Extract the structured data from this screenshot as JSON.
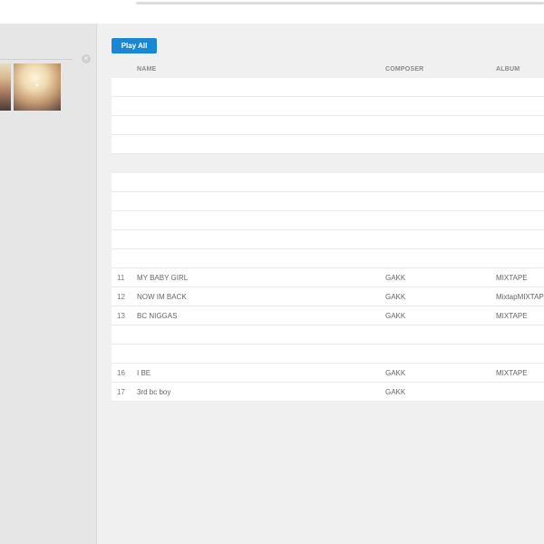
{
  "toolbar": {
    "play_all_label": "Play All"
  },
  "table": {
    "columns": {
      "name": "NAME",
      "composer": "COMPOSER",
      "album": "ALBUM"
    },
    "rows": [
      {
        "num": "",
        "name": "",
        "composer": "",
        "album": ""
      },
      {
        "num": "",
        "name": "",
        "composer": "",
        "album": ""
      },
      {
        "num": "",
        "name": "",
        "composer": "",
        "album": ""
      },
      {
        "num": "",
        "name": "",
        "composer": "",
        "album": ""
      },
      {
        "gap": true
      },
      {
        "num": "",
        "name": "",
        "composer": "",
        "album": ""
      },
      {
        "num": "",
        "name": "",
        "composer": "",
        "album": ""
      },
      {
        "num": "",
        "name": "",
        "composer": "",
        "album": ""
      },
      {
        "num": "",
        "name": "",
        "composer": "",
        "album": ""
      },
      {
        "num": "",
        "name": "",
        "composer": "",
        "album": ""
      },
      {
        "num": "11",
        "name": "MY BABY GIRL",
        "composer": "GAKK",
        "album": "MIXTAPE"
      },
      {
        "num": "12",
        "name": "NOW IM BACK",
        "composer": "GAKK",
        "album": "MixtapMIXTAPE"
      },
      {
        "num": "13",
        "name": "BC NIGGAS",
        "composer": "GAKK",
        "album": "MIXTAPE"
      },
      {
        "num": "",
        "name": "",
        "composer": "",
        "album": ""
      },
      {
        "num": "",
        "name": "",
        "composer": "",
        "album": ""
      },
      {
        "num": "16",
        "name": "I BE",
        "composer": "GAKK",
        "album": "MIXTAPE"
      },
      {
        "num": "17",
        "name": "3rd bc boy",
        "composer": "GAKK",
        "album": ""
      }
    ]
  }
}
